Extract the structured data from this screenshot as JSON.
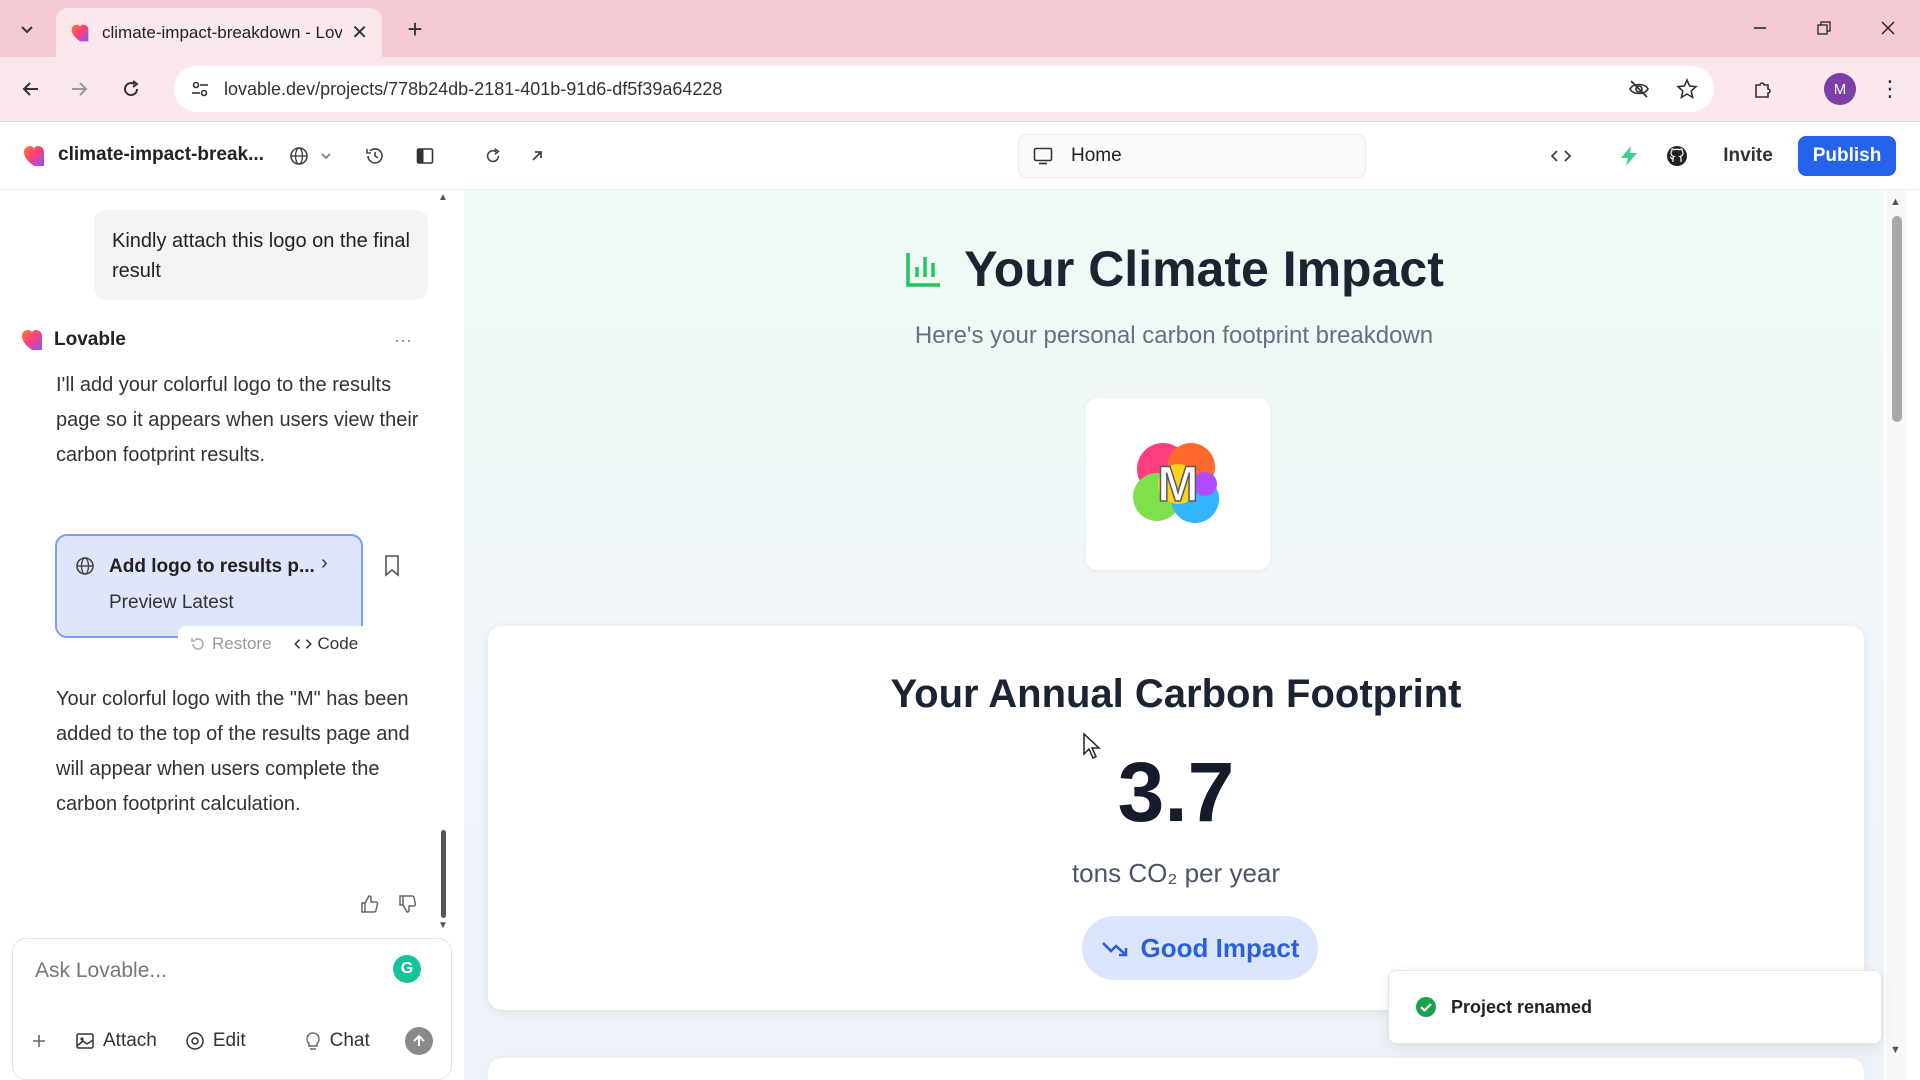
{
  "browser": {
    "tab_title": "climate-impact-breakdown - Lovable",
    "url": "lovable.dev/projects/778b24db-2181-401b-91d6-df5f39a64228",
    "avatar_letter": "M"
  },
  "header": {
    "project_name": "climate-impact-break...",
    "route": "Home",
    "invite_label": "Invite",
    "publish_label": "Publish"
  },
  "chat": {
    "user_message": "Kindly attach this logo on the final result",
    "assistant_name": "Lovable",
    "assistant_message_1": "I'll add your colorful logo to the results page so it appears when users view their carbon footprint results.",
    "edit_card": {
      "title": "Add logo to results p...",
      "subtitle": "Preview Latest",
      "restore_label": "Restore",
      "code_label": "Code"
    },
    "assistant_message_2": "Your colorful logo with the \"M\" has been added to the top of the results page and will appear when users complete the carbon footprint calculation."
  },
  "composer": {
    "placeholder": "Ask Lovable...",
    "attach_label": "Attach",
    "edit_label": "Edit",
    "chat_label": "Chat"
  },
  "preview": {
    "heading": "Your Climate Impact",
    "subheading": "Here's your personal carbon footprint breakdown",
    "logo_letter": "M",
    "card_title": "Your Annual Carbon Footprint",
    "footprint_value": "3.7",
    "footprint_unit": "tons CO₂ per year",
    "badge_label": "Good Impact"
  },
  "toast": {
    "message": "Project renamed"
  },
  "colors": {
    "publish": "#2563eb",
    "brand_pink": "#f5cad2",
    "badge_bg": "#dbe6fd",
    "badge_text": "#2c5fd8",
    "success": "#16a34a",
    "chart_icon": "#22c55e"
  }
}
